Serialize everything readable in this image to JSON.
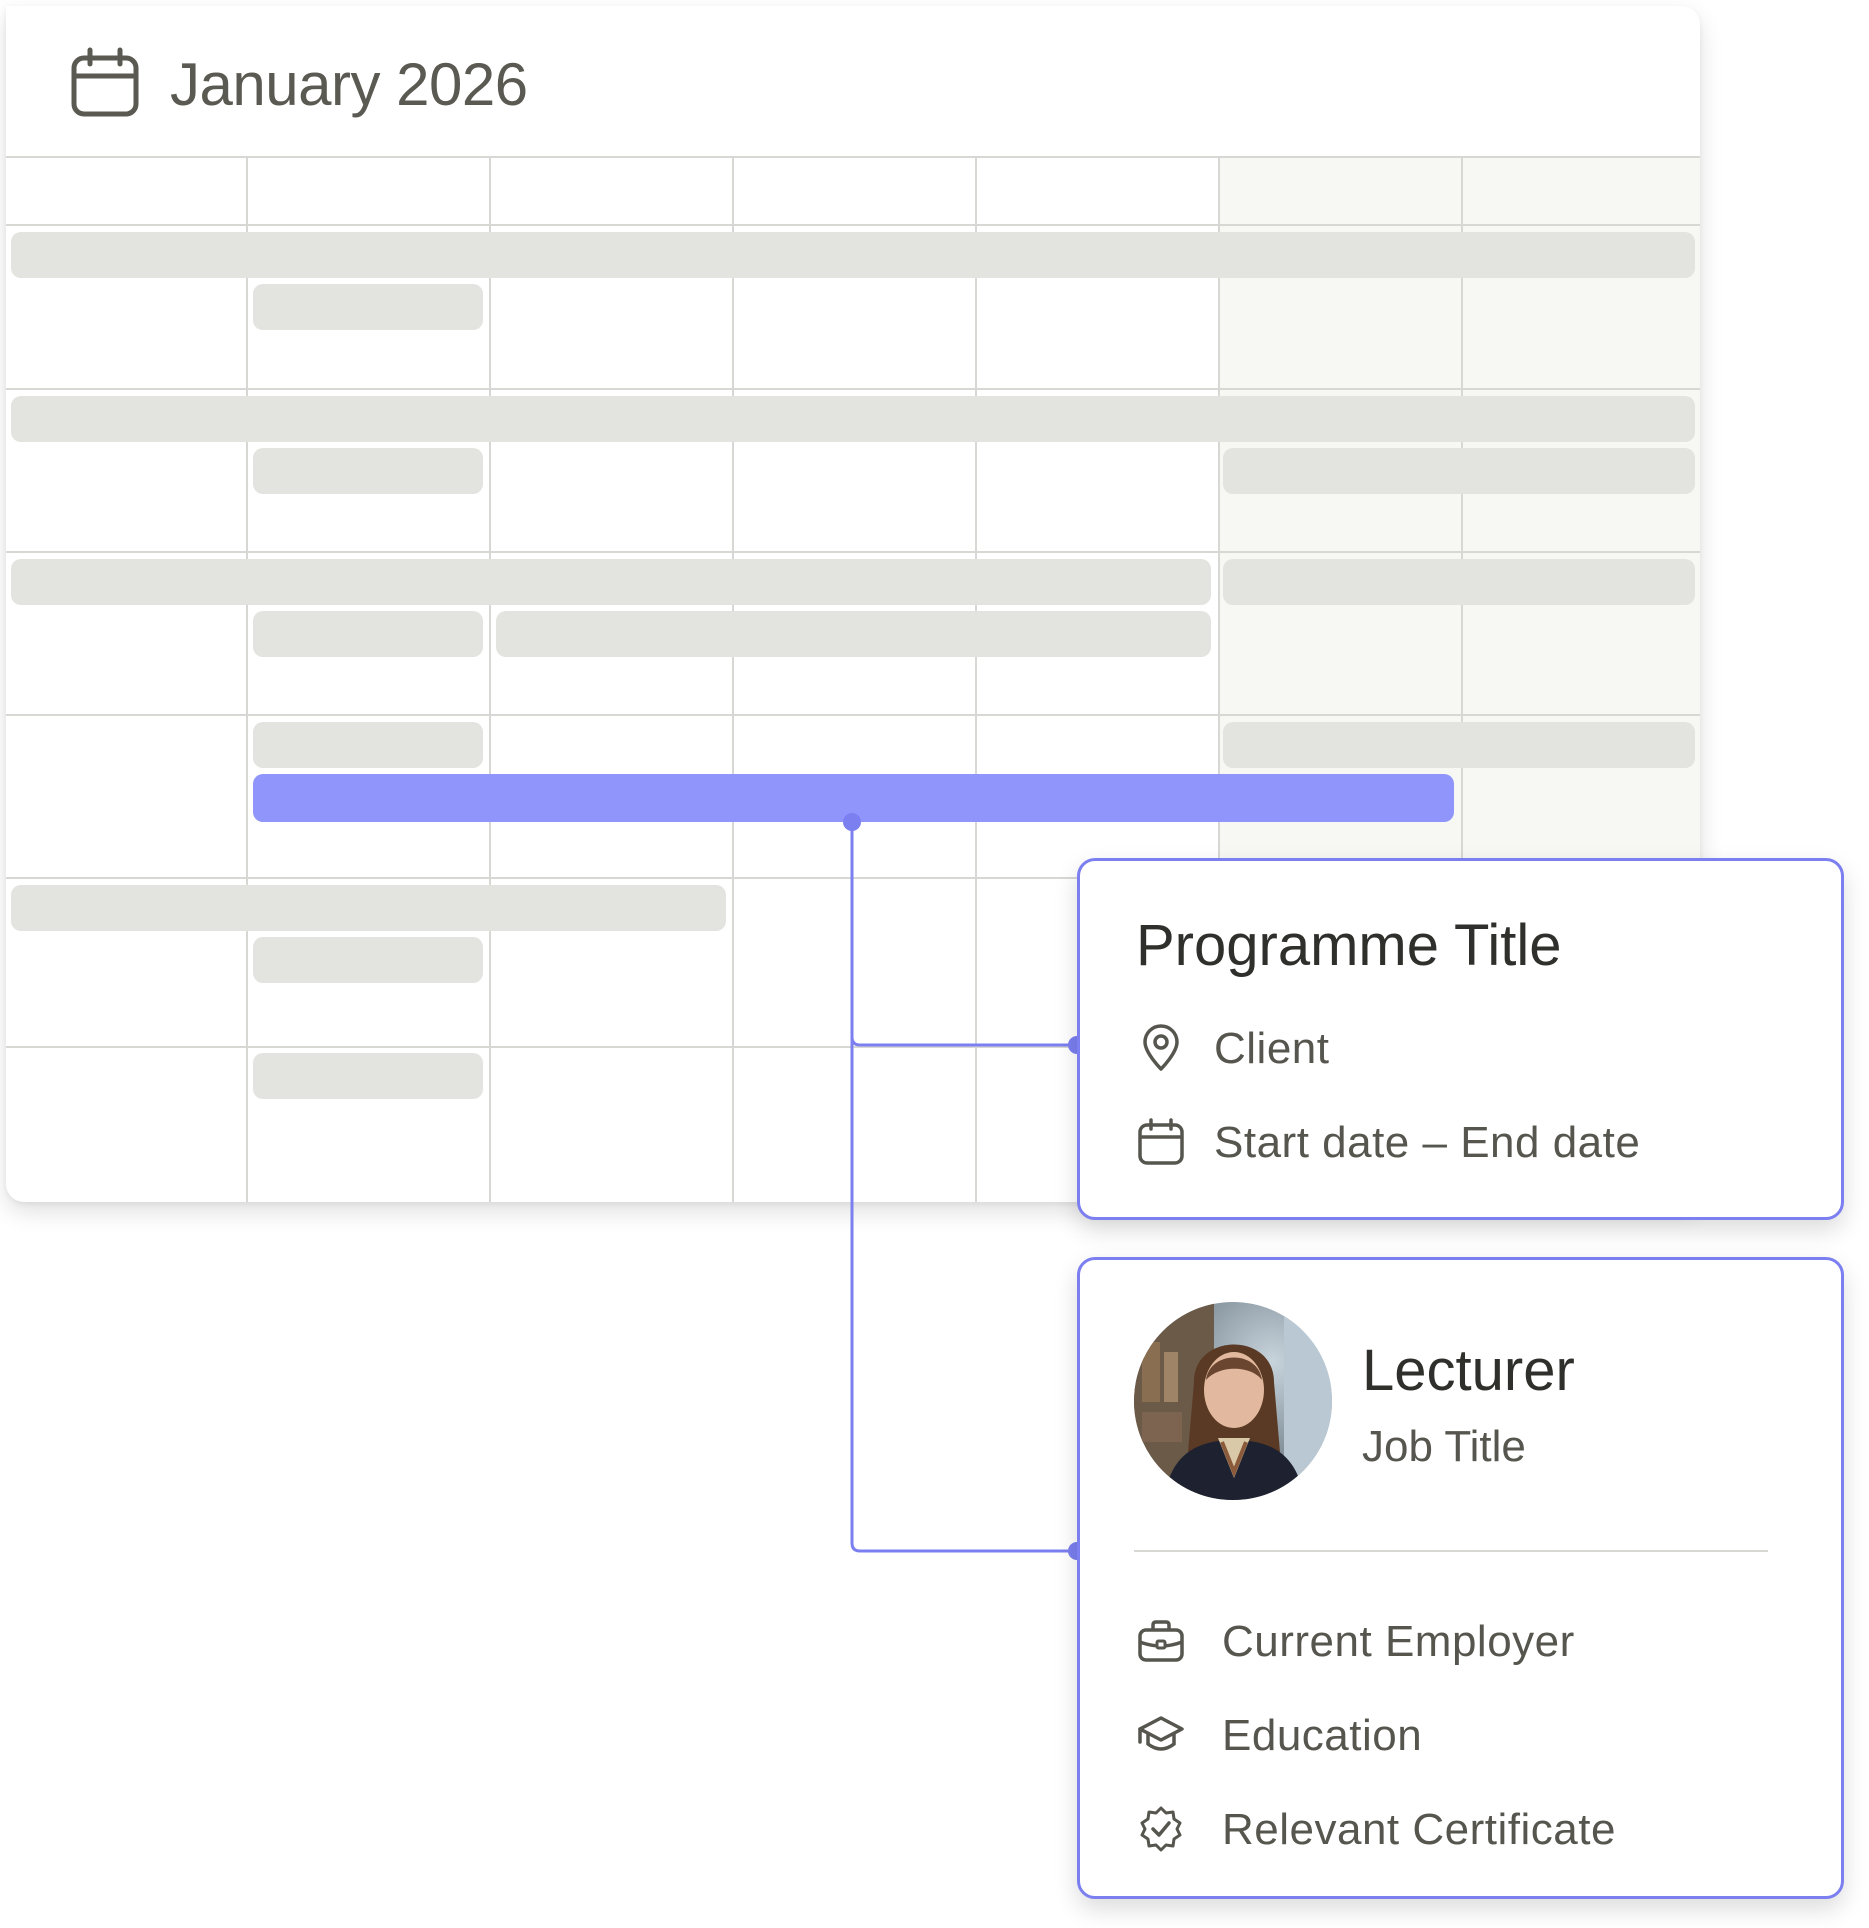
{
  "calendar": {
    "month_title": "January 2026"
  },
  "programme_card": {
    "title": "Programme Title",
    "client_label": "Client",
    "dates_label": "Start date – End date"
  },
  "lecturer_card": {
    "name": "Lecturer",
    "job_title": "Job Title",
    "details": {
      "employer": "Current Employer",
      "education": "Education",
      "certificate": "Relevant Certificate"
    }
  },
  "colors": {
    "accent": "#7b7ff0",
    "highlight_bar": "#8f95fb",
    "placeholder_bar": "#e3e3df",
    "weekend_bg": "#f7f7f3",
    "grid_line": "#d7d7d3"
  },
  "icons": {
    "header": "calendar-icon",
    "client": "location-pin-icon",
    "dates": "calendar-icon",
    "employer": "briefcase-icon",
    "education": "graduation-cap-icon",
    "certificate": "certificate-badge-icon"
  }
}
